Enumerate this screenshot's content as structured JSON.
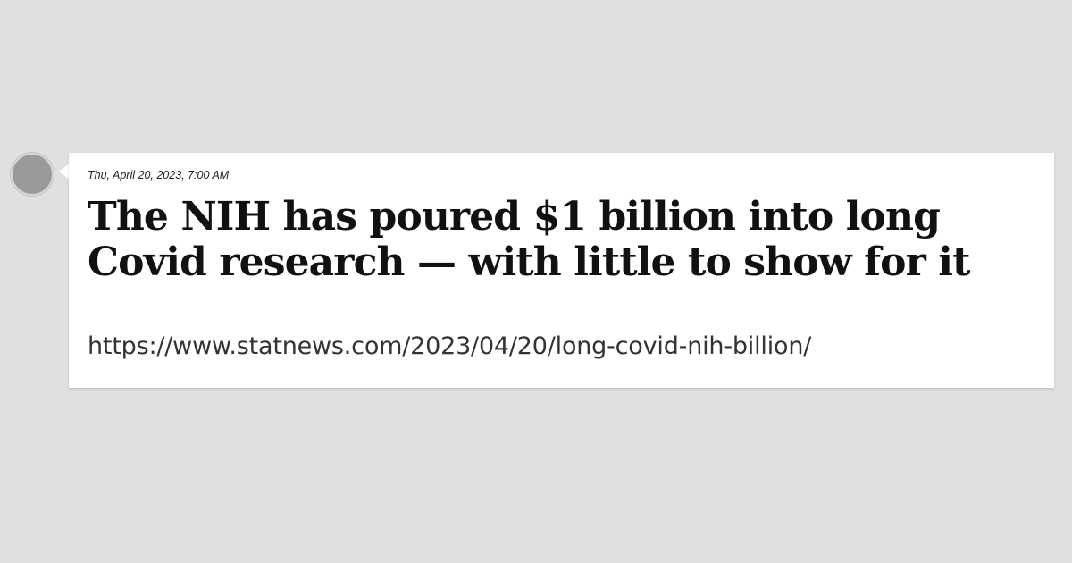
{
  "post": {
    "timestamp": "Thu, April 20, 2023, 7:00 AM",
    "headline": "The NIH has poured $1 billion into long Covid research — with little to show for it",
    "url": "https://www.statnews.com/2023/04/20/long-covid-nih-billion/"
  },
  "colors": {
    "background": "#e0e0e0",
    "card": "#ffffff",
    "avatar": "#9a9a9a",
    "text": "#111111"
  }
}
